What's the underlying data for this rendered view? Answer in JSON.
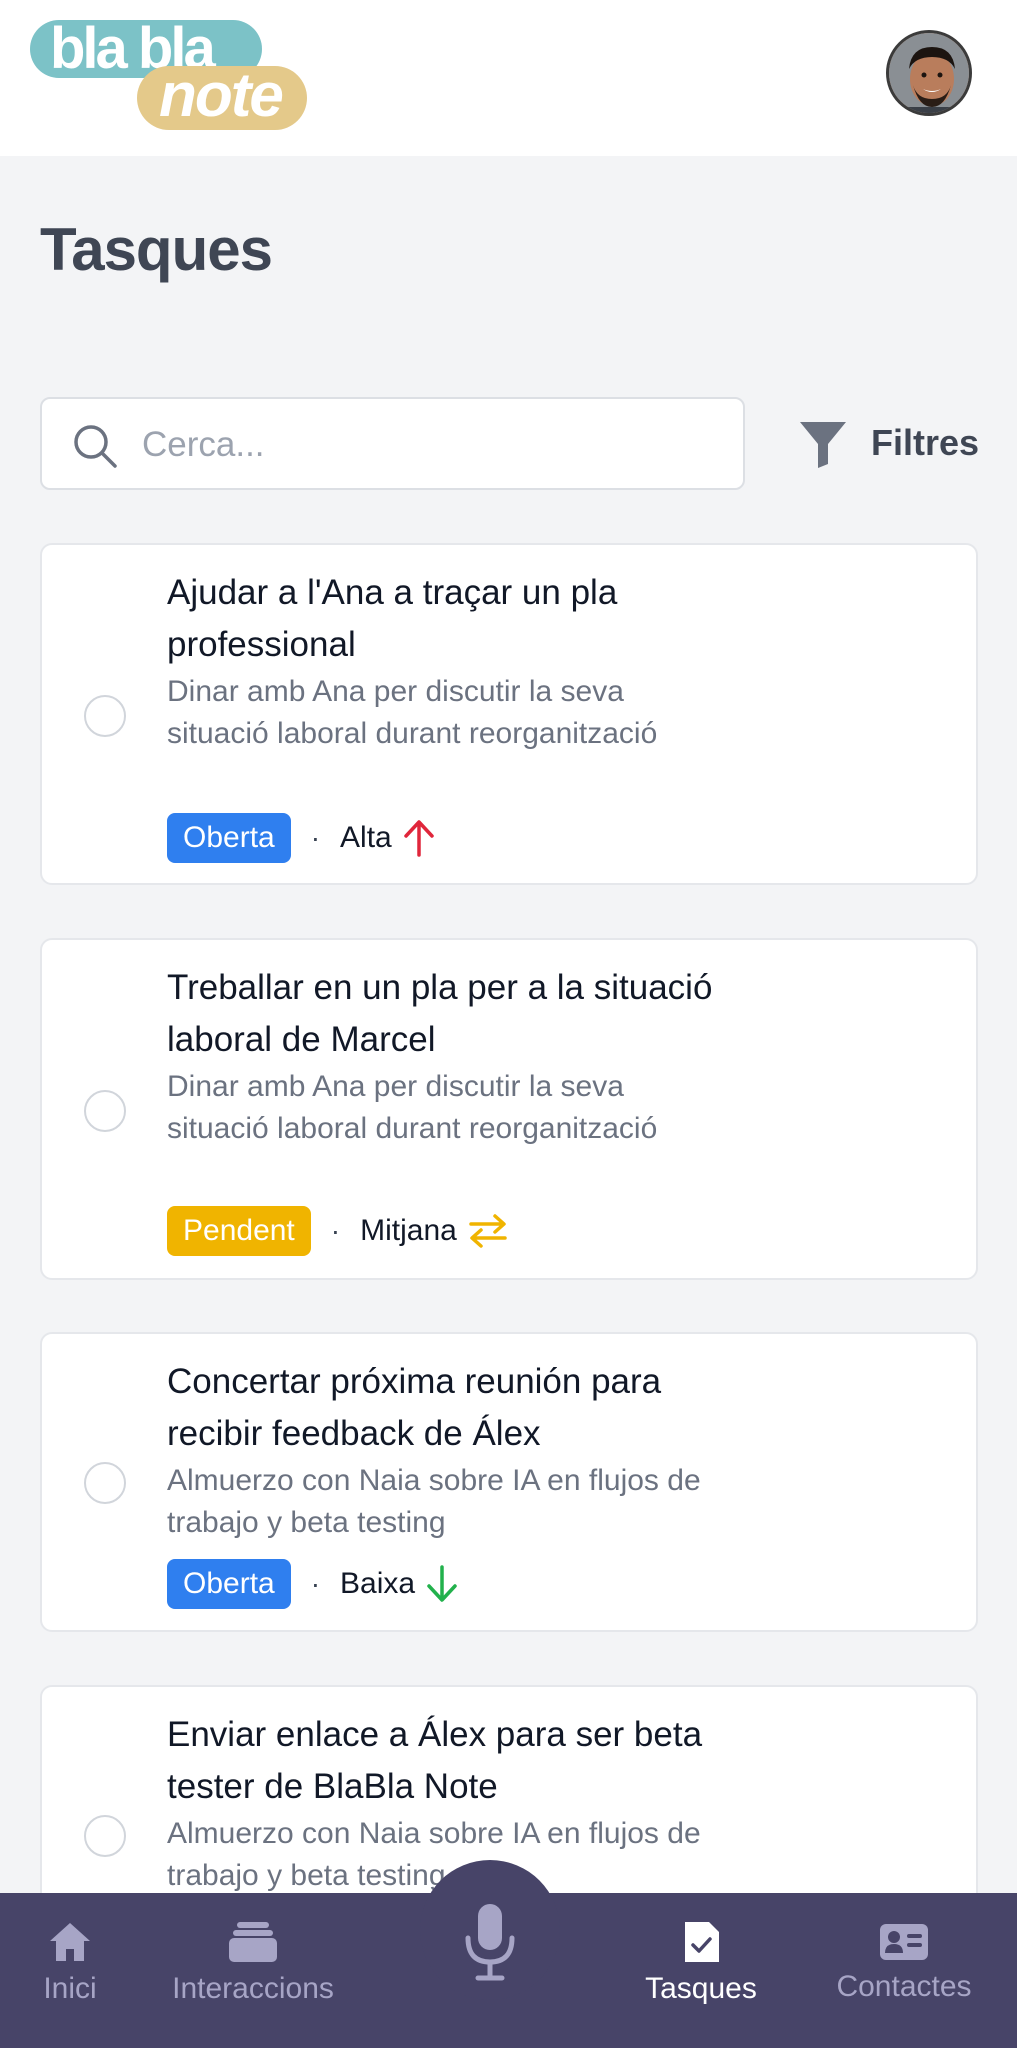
{
  "app": {
    "logo_top": "bla bla",
    "logo_bottom": "note"
  },
  "page": {
    "title": "Tasques"
  },
  "search": {
    "placeholder": "Cerca...",
    "value": ""
  },
  "filter": {
    "label": "Filtres"
  },
  "tasks": [
    {
      "title": "Ajudar a l'Ana a traçar un pla professional",
      "description": "Dinar amb Ana per discutir la seva situació laboral durant reorganització",
      "status": "Oberta",
      "priority": "Alta",
      "priority_icon": "arrow-up-icon"
    },
    {
      "title": "Treballar en un pla per a la situació laboral de Marcel",
      "description": "Dinar amb Ana per discutir la seva situació laboral durant reorganització",
      "status": "Pendent",
      "priority": "Mitjana",
      "priority_icon": "swap-arrows-icon"
    },
    {
      "title": "Concertar próxima reunión para recibir feedback de Álex",
      "description": "Almuerzo con Naia sobre IA en flujos de trabajo y beta testing",
      "status": "Oberta",
      "priority": "Baixa",
      "priority_icon": "arrow-down-icon"
    },
    {
      "title": "Enviar enlace a Álex para ser beta tester de BlaBla Note",
      "description": "Almuerzo con Naia sobre IA en flujos de trabajo y beta testing"
    }
  ],
  "nav": {
    "items": [
      {
        "label": "Inici",
        "icon": "home-icon",
        "active": false
      },
      {
        "label": "Interaccions",
        "icon": "stack-icon",
        "active": false
      },
      {
        "label": "",
        "icon": "microphone-icon",
        "active": false
      },
      {
        "label": "Tasques",
        "icon": "task-check-icon",
        "active": true
      },
      {
        "label": "Contactes",
        "icon": "contact-card-icon",
        "active": false
      }
    ]
  },
  "colors": {
    "open_badge": "#2f7fef",
    "pending_badge": "#f0b400",
    "priority_high": "#e0263b",
    "priority_medium": "#f0b400",
    "priority_low": "#22b14c",
    "nav_background": "#474468"
  }
}
